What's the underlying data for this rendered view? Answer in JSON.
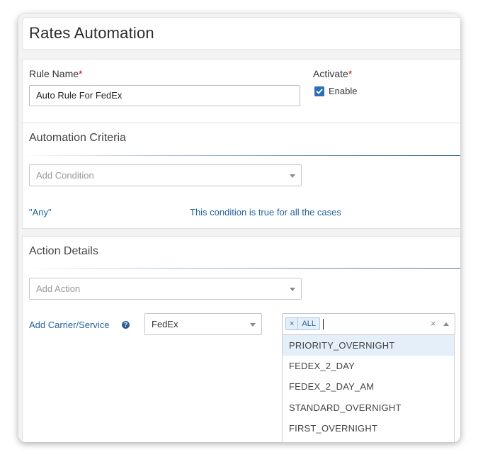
{
  "page": {
    "title": "Rates Automation"
  },
  "rule": {
    "name_label": "Rule Name",
    "name_required": "*",
    "name_value": "Auto Rule For FedEx",
    "activate_label": "Activate",
    "activate_required": "*",
    "enable_label": "Enable",
    "enabled": true
  },
  "criteria": {
    "title": "Automation Criteria",
    "add_condition_placeholder": "Add Condition",
    "any_label": "\"Any\"",
    "any_description": "This condition is true for all the cases"
  },
  "action": {
    "title": "Action Details",
    "add_action_placeholder": "Add Action",
    "carrier_label": "Add Carrier/Service",
    "help_glyph": "?",
    "carrier_value": "FedEx",
    "selected_tags": [
      {
        "remove": "×",
        "label": "ALL"
      }
    ],
    "clear_glyph": "×",
    "options": [
      "PRIORITY_OVERNIGHT",
      "FEDEX_2_DAY",
      "FEDEX_2_DAY_AM",
      "STANDARD_OVERNIGHT",
      "FIRST_OVERNIGHT"
    ],
    "highlighted_option": "PRIORITY_OVERNIGHT"
  },
  "icons": {
    "checkbox": "check-icon",
    "help": "help-circle-icon",
    "dropdown": "chevron-down-icon",
    "collapse": "chevron-up-icon",
    "clear": "close-icon"
  },
  "colors": {
    "accent": "#2d6fb6",
    "link": "#23639d",
    "required": "#d0021b",
    "highlight": "#e4eff9"
  }
}
